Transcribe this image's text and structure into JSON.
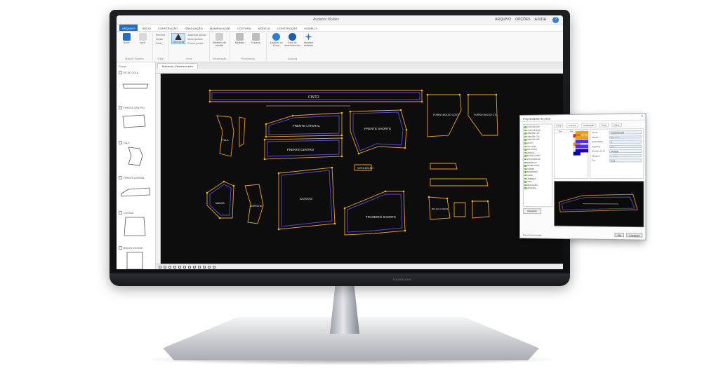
{
  "window": {
    "title": "Audaces Moldes",
    "user_menu": [
      "ARQUIVO",
      "OPÇÕES",
      "AJUDA"
    ],
    "help_symbol": "?"
  },
  "ribbon": {
    "tabs": [
      {
        "label": "ARQUIVO",
        "active": true
      },
      {
        "label": "INÍCIO",
        "active": false
      },
      {
        "label": "CONSTRUÇÃO",
        "active": false
      },
      {
        "label": "GRADUAÇÃO",
        "active": false
      },
      {
        "label": "MANIPULAÇÃO",
        "active": false
      },
      {
        "label": "COSTURA",
        "active": false
      },
      {
        "label": "MODELO",
        "active": false
      },
      {
        "label": "CONSTRUÇÃO",
        "active": false
      },
      {
        "label": "MODELO",
        "active": false
      }
    ],
    "groups": [
      {
        "label": "Área de Trabalho",
        "buttons": [
          "Novo",
          "Abrir",
          "Salvar"
        ]
      },
      {
        "label": "Editar",
        "small": [
          "Recortar",
          "Copiar",
          "Colar"
        ]
      },
      {
        "label": "Linha",
        "buttons": [
          "Selecionar"
        ],
        "small": [
          "Adicionar pontos",
          "Mover pontos",
          "Excluir pontos"
        ]
      },
      {
        "label": "Visualização",
        "buttons": [
          "Relatório de modelo"
        ]
      },
      {
        "label": "Ferramentas",
        "buttons": [
          "Medidas",
          "Encaixe"
        ]
      },
      {
        "label": "Audaces",
        "buttons": [
          "Audaces on Cloud",
          "Área do desenvolvedor",
          "Atualizar software"
        ]
      }
    ],
    "colors": {
      "accent": "#1f6fc5",
      "cloud": "#2f7fd1",
      "logo": "#1d5fae",
      "snow": "#3a7bc8"
    }
  },
  "sidebar": {
    "header": "Peças",
    "pieces": [
      {
        "label": "PÉ DE GOLA"
      },
      {
        "label": "FRENTE CENTRO"
      },
      {
        "label": "FALA"
      },
      {
        "label": "FRENTE LATERAL"
      },
      {
        "label": "COSTAS"
      },
      {
        "label": "BOLSO COSTAS"
      }
    ]
  },
  "document": {
    "tab_label": "Macacao_Feminino.adm"
  },
  "cad_pieces": {
    "labels": {
      "cinto": "CINTO",
      "frente_lateral": "FRENTE LATERAL",
      "frente_shorts": "FRENTE SHORTS",
      "frente_centro": "FRENTE CENTRO",
      "costas": "COSTAS",
      "manga": "MANGA",
      "fala": "FALA",
      "vista_bolso": "VISTA BOLSO",
      "espelho": "ESPELHO",
      "traseiro_shorts": "TRASEIRO SHORTS",
      "forro_bolso_cost": "FORRO BOLSO COST",
      "forro_bolso_ctl": "FORRO BOLSO CTL",
      "bolso_costas": "BOLSO COSTAS"
    },
    "colors": {
      "outline": "#f0a020",
      "inner": "#5b4bd6",
      "point": "#f3b229",
      "grain": "#e8e8e8",
      "seam": "#6a55ff"
    }
  },
  "dialog": {
    "title": "Propriedades da peça",
    "close_symbol": "×",
    "tree_items": [
      "COSTAS DIR",
      "COSTAS ESQ",
      "FRENTE LAT",
      "FRENTE CTL",
      "FRENTE DIR",
      "CINTO",
      "FALA DIR",
      "FALA ESQ",
      "MANGA",
      "BOLSO COST",
      "VISTA BOLSO",
      "ESPELHO",
      "PÉ DE GOLA",
      "FORRO",
      "TRASEIRO",
      "GOLA",
      "LIMPEZA",
      "CÓS",
      "MACACÃO",
      "MOLDES"
    ],
    "tabs": [
      "Geral",
      "Costura",
      "Graduação",
      "Corte",
      "Notas"
    ],
    "grid_headers": [
      "Tam",
      "Ref",
      "Cor"
    ],
    "swatches": [
      "#d61c1c",
      "#e8e8e8",
      "#f08c00",
      "#ffffff",
      "#0000a8"
    ],
    "props": [
      {
        "name": "Nome",
        "value": "COSTAS DIR"
      },
      {
        "name": "Tecido",
        "value": "Principal"
      },
      {
        "name": "Quantidade",
        "value": "2"
      },
      {
        "name": "Espelhar",
        "value": "Sim"
      },
      {
        "name": "Sentido do fio",
        "value": "Vertical"
      },
      {
        "name": "Margem",
        "value": "1,0 cm"
      },
      {
        "name": "Cor",
        "value": "Azul"
      }
    ],
    "right_swatches": [
      "#f0a000",
      "#f0a000",
      "#4b2fff",
      "#4b2fff",
      "#2000a0"
    ],
    "preview_label": "Visualizar",
    "ok_label": "OK",
    "cancel_label": "Cancelar",
    "status": "Peças selecionadas"
  },
  "monitor": {
    "brand": "SAMSUNG"
  }
}
